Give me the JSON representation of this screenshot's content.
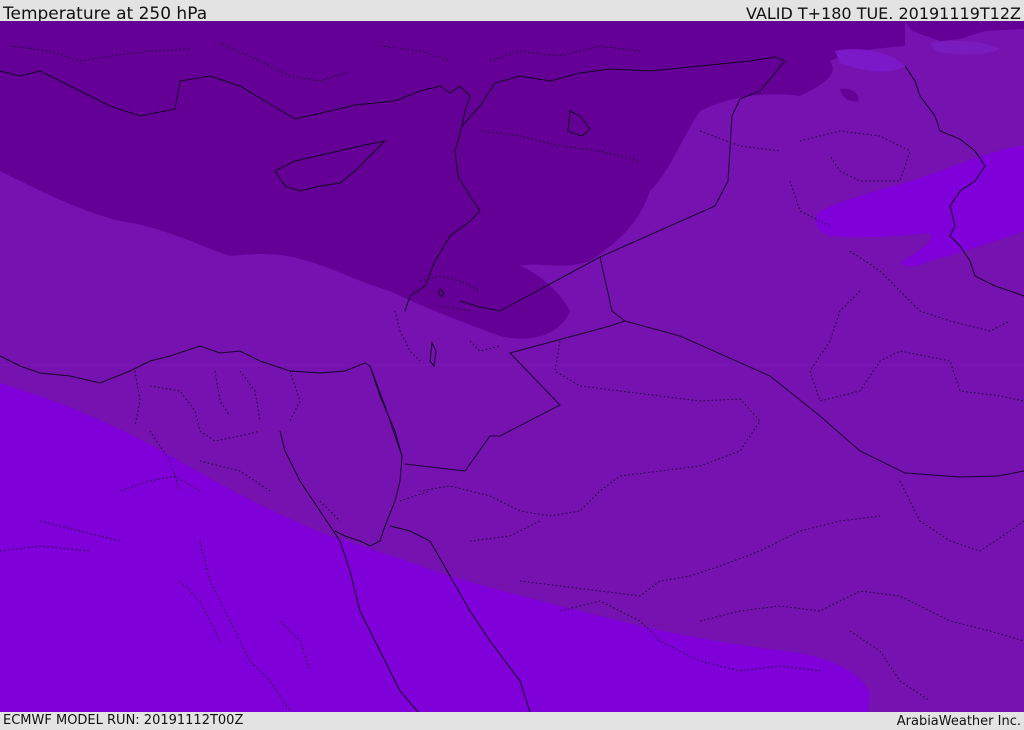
{
  "header": {
    "title": "Temperature at 250 hPa",
    "valid": "VALID T+180 TUE. 20191119T12Z"
  },
  "footer": {
    "model_run": "ECMWF MODEL RUN: 20191112T00Z",
    "credit": "ArabiaWeather Inc."
  },
  "map": {
    "colors": {
      "coldest_band": "#650096",
      "middle_band": "#7512b0",
      "warm_band": "#7f00d9",
      "border_lines": "#1a0630"
    }
  }
}
